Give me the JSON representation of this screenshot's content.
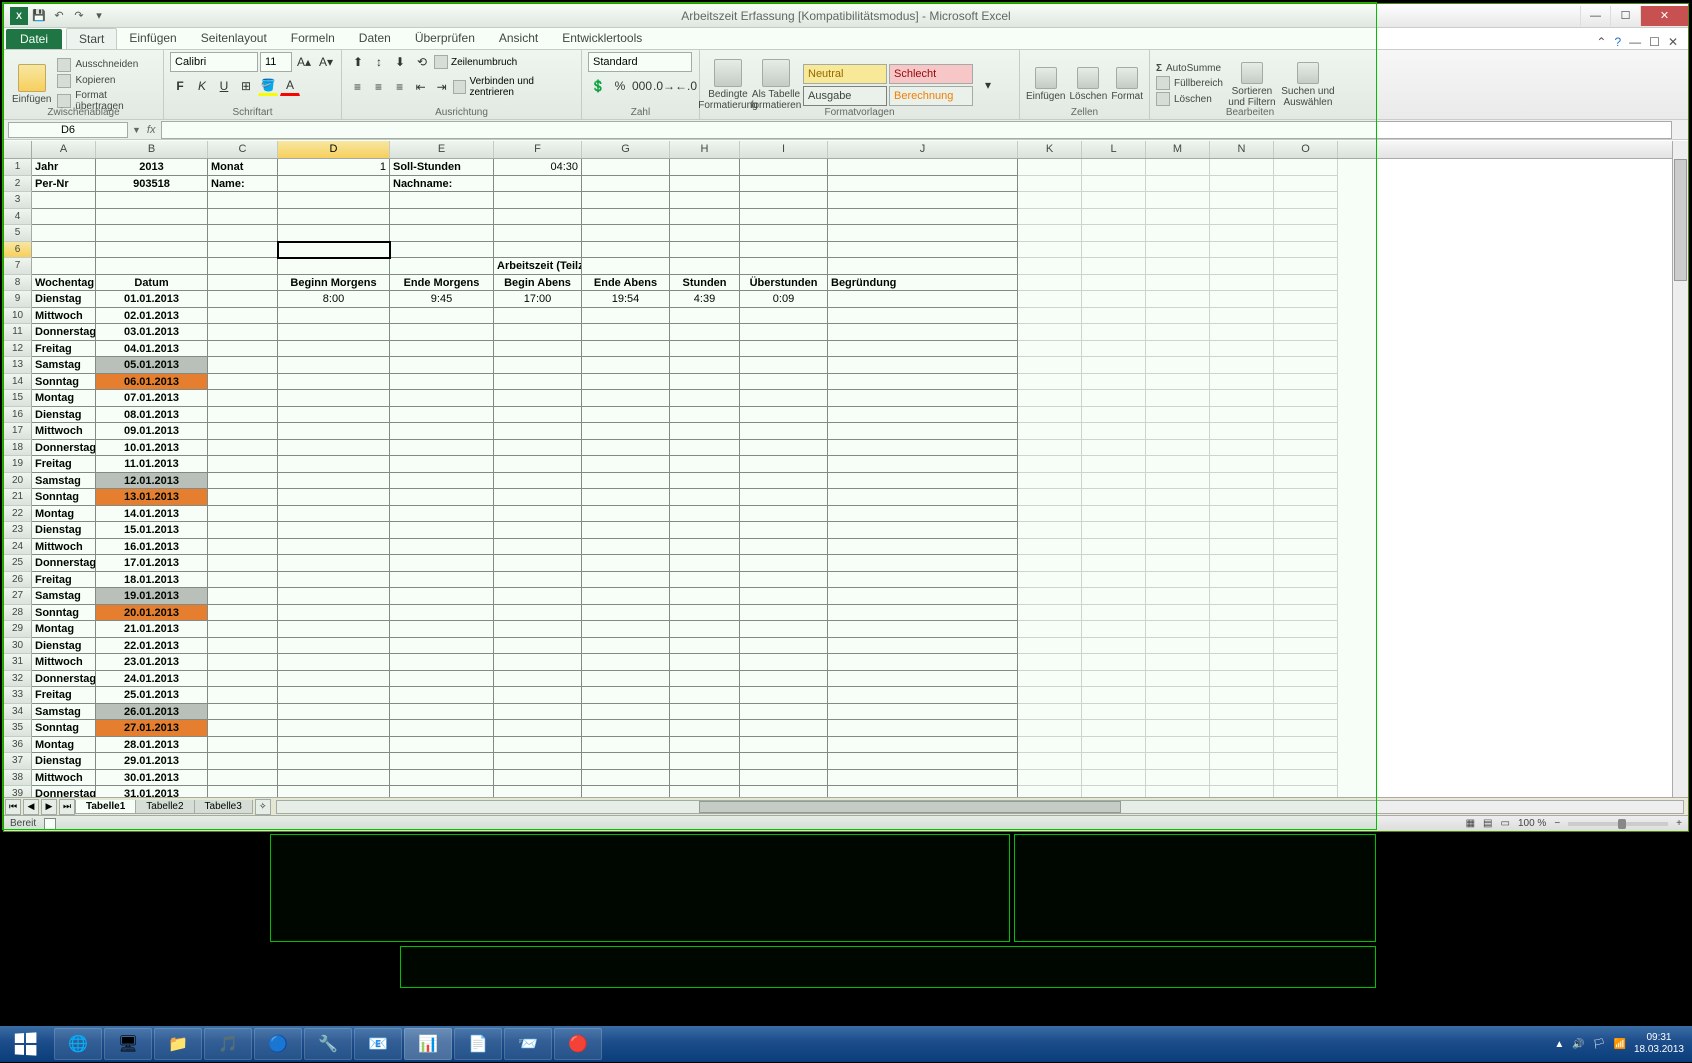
{
  "window": {
    "title": "Arbeitszeit Erfassung  [Kompatibilitätsmodus] - Microsoft Excel",
    "qat": [
      "save",
      "undo",
      "redo",
      "print"
    ]
  },
  "tabs": {
    "file": "Datei",
    "items": [
      "Start",
      "Einfügen",
      "Seitenlayout",
      "Formeln",
      "Daten",
      "Überprüfen",
      "Ansicht",
      "Entwicklertools"
    ],
    "active": 0
  },
  "ribbon": {
    "clipboard": {
      "label": "Zwischenablage",
      "paste": "Einfügen",
      "cut": "Ausschneiden",
      "copy": "Kopieren",
      "painter": "Format übertragen"
    },
    "font": {
      "label": "Schriftart",
      "family": "Calibri",
      "size": "11"
    },
    "align": {
      "label": "Ausrichtung",
      "wrap": "Zeilenumbruch",
      "merge": "Verbinden und zentrieren"
    },
    "number": {
      "label": "Zahl",
      "format": "Standard"
    },
    "styles": {
      "label": "Formatvorlagen",
      "cond": "Bedingte\nFormatierung",
      "table": "Als Tabelle\nformatieren",
      "neutral": "Neutral",
      "bad": "Schlecht",
      "output": "Ausgabe",
      "calc": "Berechnung"
    },
    "cells": {
      "label": "Zellen",
      "insert": "Einfügen",
      "delete": "Löschen",
      "format": "Format"
    },
    "editing": {
      "label": "Bearbeiten",
      "sum": "AutoSumme",
      "fill": "Füllbereich",
      "clear": "Löschen",
      "sort": "Sortieren\nund Filtern",
      "find": "Suchen und\nAuswählen"
    }
  },
  "namebox": "D6",
  "formula": "",
  "columns": {
    "letters": [
      "A",
      "B",
      "C",
      "D",
      "E",
      "F",
      "G",
      "H",
      "I",
      "J",
      "K",
      "L",
      "M",
      "N",
      "O"
    ],
    "widths": [
      64,
      112,
      70,
      112,
      104,
      88,
      88,
      70,
      88,
      190,
      64,
      64,
      64,
      64,
      64
    ],
    "selected": 3
  },
  "header_rows": {
    "r1": {
      "A": "Jahr",
      "B": "2013",
      "C": "Monat",
      "D": "1",
      "E": "Soll-Stunden",
      "F": "04:30"
    },
    "r2": {
      "A": "Per-Nr",
      "B": "903518",
      "C": "Name:",
      "E": "Nachname:"
    }
  },
  "section_title": "Arbeitszeit (Teilzeit)",
  "table_headers": {
    "A": "Wochentag",
    "B": "Datum",
    "D": "Beginn Morgens",
    "E": "Ende Morgens",
    "F": "Begin Abens",
    "G": "Ende Abens",
    "H": "Stunden",
    "I": "Überstunden",
    "J": "Begründung"
  },
  "data": [
    {
      "wd": "Dienstag",
      "dt": "01.01.2013",
      "bm": "8:00",
      "em": "9:45",
      "ba": "17:00",
      "ea": "19:54",
      "st": "4:39",
      "us": "0:09",
      "hl": ""
    },
    {
      "wd": "Mittwoch",
      "dt": "02.01.2013",
      "hl": ""
    },
    {
      "wd": "Donnerstag",
      "dt": "03.01.2013",
      "hl": ""
    },
    {
      "wd": "Freitag",
      "dt": "04.01.2013",
      "hl": ""
    },
    {
      "wd": "Samstag",
      "dt": "05.01.2013",
      "hl": "gray"
    },
    {
      "wd": "Sonntag",
      "dt": "06.01.2013",
      "hl": "orange"
    },
    {
      "wd": "Montag",
      "dt": "07.01.2013",
      "hl": ""
    },
    {
      "wd": "Dienstag",
      "dt": "08.01.2013",
      "hl": ""
    },
    {
      "wd": "Mittwoch",
      "dt": "09.01.2013",
      "hl": ""
    },
    {
      "wd": "Donnerstag",
      "dt": "10.01.2013",
      "hl": ""
    },
    {
      "wd": "Freitag",
      "dt": "11.01.2013",
      "hl": ""
    },
    {
      "wd": "Samstag",
      "dt": "12.01.2013",
      "hl": "gray"
    },
    {
      "wd": "Sonntag",
      "dt": "13.01.2013",
      "hl": "orange"
    },
    {
      "wd": "Montag",
      "dt": "14.01.2013",
      "hl": ""
    },
    {
      "wd": "Dienstag",
      "dt": "15.01.2013",
      "hl": ""
    },
    {
      "wd": "Mittwoch",
      "dt": "16.01.2013",
      "hl": ""
    },
    {
      "wd": "Donnerstag",
      "dt": "17.01.2013",
      "hl": ""
    },
    {
      "wd": "Freitag",
      "dt": "18.01.2013",
      "hl": ""
    },
    {
      "wd": "Samstag",
      "dt": "19.01.2013",
      "hl": "gray"
    },
    {
      "wd": "Sonntag",
      "dt": "20.01.2013",
      "hl": "orange"
    },
    {
      "wd": "Montag",
      "dt": "21.01.2013",
      "hl": ""
    },
    {
      "wd": "Dienstag",
      "dt": "22.01.2013",
      "hl": ""
    },
    {
      "wd": "Mittwoch",
      "dt": "23.01.2013",
      "hl": ""
    },
    {
      "wd": "Donnerstag",
      "dt": "24.01.2013",
      "hl": ""
    },
    {
      "wd": "Freitag",
      "dt": "25.01.2013",
      "hl": ""
    },
    {
      "wd": "Samstag",
      "dt": "26.01.2013",
      "hl": "gray"
    },
    {
      "wd": "Sonntag",
      "dt": "27.01.2013",
      "hl": "orange"
    },
    {
      "wd": "Montag",
      "dt": "28.01.2013",
      "hl": ""
    },
    {
      "wd": "Dienstag",
      "dt": "29.01.2013",
      "hl": ""
    },
    {
      "wd": "Mittwoch",
      "dt": "30.01.2013",
      "hl": ""
    },
    {
      "wd": "Donnerstag",
      "dt": "31.01.2013",
      "hl": ""
    }
  ],
  "selected_row": 6,
  "sheets": {
    "tabs": [
      "Tabelle1",
      "Tabelle2",
      "Tabelle3"
    ],
    "active": 0
  },
  "status": {
    "ready": "Bereit",
    "zoom": "100 %"
  },
  "taskbar": {
    "apps": [
      "ie",
      "desktop",
      "explorer",
      "wmp",
      "chrome",
      "tool",
      "outlook",
      "excel",
      "word",
      "outlook2",
      "filezilla"
    ],
    "active": 7,
    "time": "09:31",
    "date": "18.03.2013"
  }
}
